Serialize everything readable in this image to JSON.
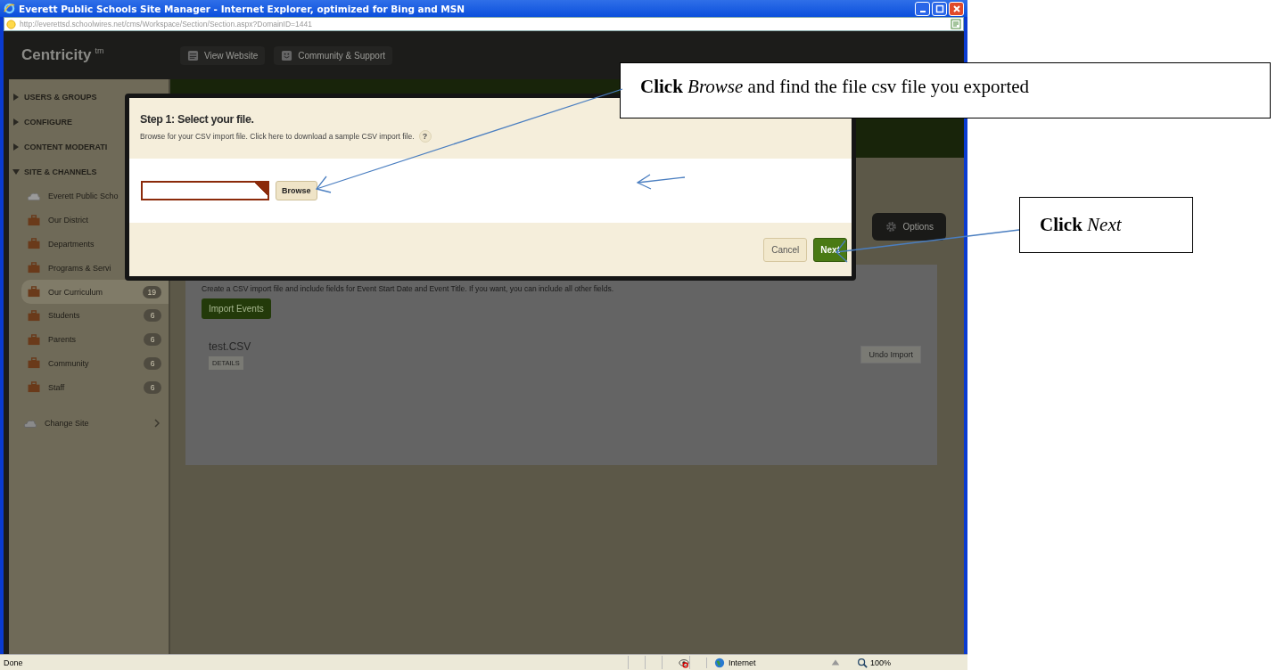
{
  "window": {
    "title": "Everett Public Schools Site Manager - Internet Explorer, optimized for Bing and MSN"
  },
  "address_bar": {
    "url": "http://everettsd.schoolwires.net/cms/Workspace/Section/Section.aspx?DomainID=1441"
  },
  "app_header": {
    "logo": "Centricity$^{tm}$",
    "nav": [
      "View Website",
      "Community & Support"
    ]
  },
  "sidebar": {
    "sections": [
      {
        "label": "USERS & GROUPS",
        "expanded": false
      },
      {
        "label": "CONFIGURE",
        "expanded": false
      },
      {
        "label": "CONTENT MODERATI",
        "expanded": false
      },
      {
        "label": "SITE & CHANNELS",
        "expanded": true,
        "children": [
          {
            "label": "Everett Public Scho",
            "kind": "site",
            "selected": false
          },
          {
            "label": "Our District",
            "kind": "channel",
            "selected": false
          },
          {
            "label": "Departments",
            "kind": "channel",
            "selected": false
          },
          {
            "label": "Programs & Servi",
            "kind": "channel",
            "selected": false
          },
          {
            "label": "Our Curriculum",
            "kind": "channel",
            "count": "19",
            "selected": true
          },
          {
            "label": "Students",
            "kind": "channel",
            "count": "6",
            "selected": false
          },
          {
            "label": "Parents",
            "kind": "channel",
            "count": "6",
            "selected": false
          },
          {
            "label": "Community",
            "kind": "channel",
            "count": "6",
            "selected": false
          },
          {
            "label": "Staff",
            "kind": "channel",
            "count": "6",
            "selected": false
          }
        ]
      }
    ],
    "change_site": "Change Site"
  },
  "main": {
    "options_button": "Options",
    "instructions": "Create a CSV import file and include fields for Event Start Date and Event Title. If you want, you can include all other fields.",
    "import_button": "Import Events",
    "file_name": "test.CSV",
    "details_badge": "DETAILS",
    "undo_button": "Undo Import"
  },
  "dialog": {
    "title": "Step 1: Select your file.",
    "description": "Browse for your CSV import file. Click here to download a sample CSV import file.",
    "help": "?",
    "browse_button": "Browse",
    "cancel_button": "Cancel",
    "next_button": "Next"
  },
  "callouts": [
    {
      "text": "**Click** *Browse* and find the file csv file you exported"
    },
    {
      "text": "**Click** *Next*"
    }
  ],
  "status_bar": {
    "status": "Done",
    "zone": "Internet",
    "zoom": "100%"
  }
}
